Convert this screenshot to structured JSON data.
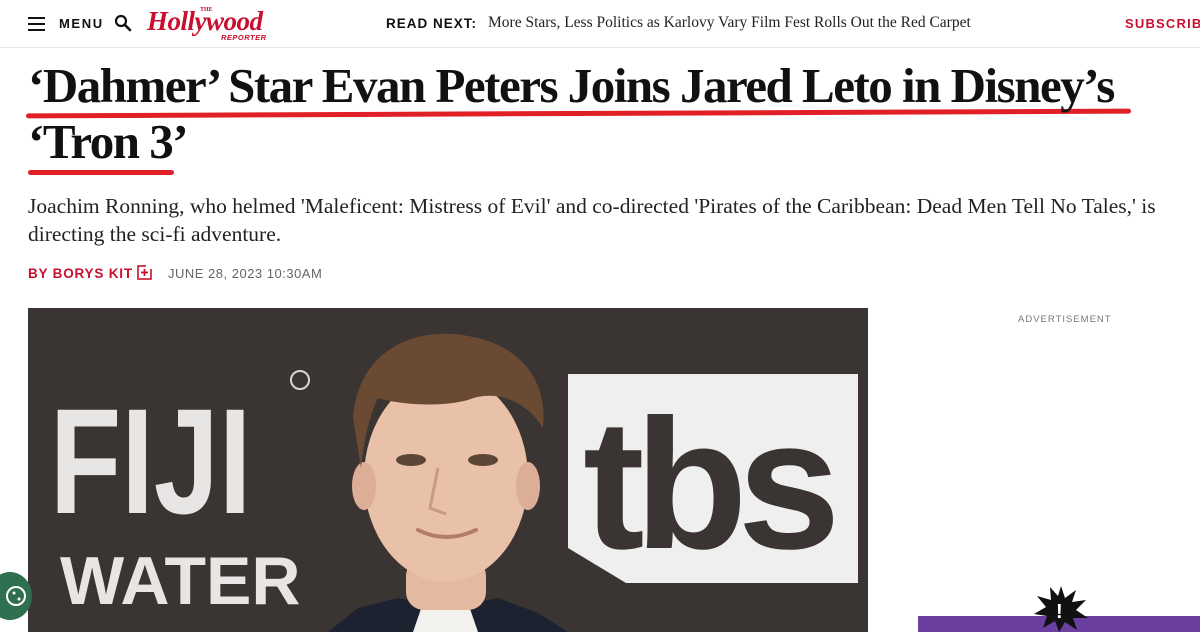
{
  "nav": {
    "menu_label": "MENU",
    "logo_the": "THE",
    "logo_word": "Hollywood",
    "logo_reporter": "REPORTER",
    "read_next_label": "READ NEXT:",
    "read_next_title": "More Stars, Less Politics as Karlovy Vary Film Fest Rolls Out the Red Carpet",
    "subscribe_label": "SUBSCRIBE"
  },
  "article": {
    "headline_line1": "‘Dahmer’ Star Evan Peters Joins Jared Leto in Disney’s",
    "headline_line2": "‘Tron 3’",
    "dek": "Joachim Ronning, who helmed 'Maleficent: Mistress of Evil' and co-directed 'Pirates of the Caribbean: Dead Men Tell No Tales,' is directing the sci-fi adventure.",
    "byline": "BY BORYS KIT",
    "date": "JUNE 28, 2023 10:30AM"
  },
  "hero": {
    "backdrop_left_line1": "FIJI",
    "backdrop_left_line2": "WATER",
    "backdrop_right": "tbs"
  },
  "rail": {
    "ad_label": "ADVERTISEMENT",
    "ad_badge": "!"
  },
  "icons": {
    "menu": "hamburger-icon",
    "search": "search-icon",
    "follow": "follow-plus-icon",
    "cookie": "cookie-icon"
  },
  "colors": {
    "brand_red": "#c8102e",
    "highlight_red": "#e01f26",
    "ad_purple": "#6a3fa0"
  }
}
